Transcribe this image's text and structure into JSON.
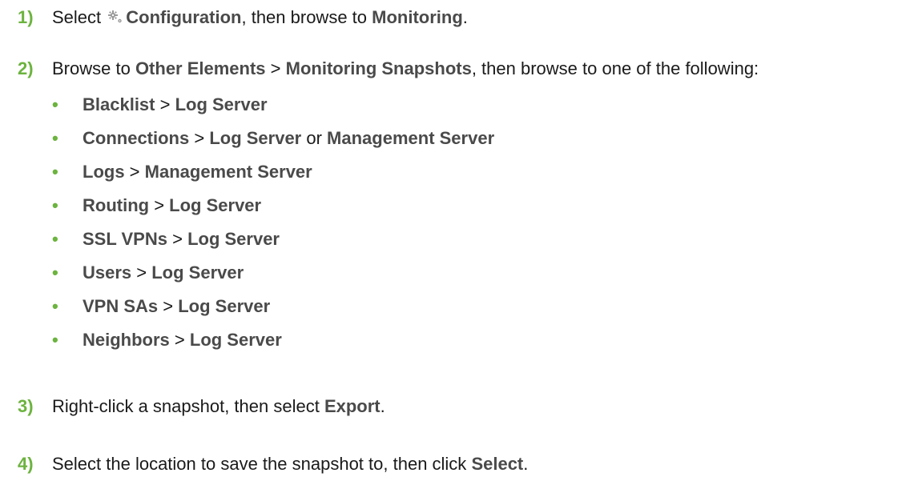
{
  "steps": [
    {
      "number": "1)",
      "select": "Select",
      "gear_icon": "gear-icon",
      "configuration": "Configuration",
      "then_browse": ", then browse to ",
      "monitoring": "Monitoring",
      "end": "."
    },
    {
      "number": "2)",
      "browse": "Browse to ",
      "other_elements": "Other Elements",
      "sep": " > ",
      "monitoring_snapshots": "Monitoring Snapshots",
      "rest": ", then browse to one of the following:",
      "items": [
        {
          "a": "Blacklist",
          "sep": " > ",
          "b": "Log Server"
        },
        {
          "a": "Connections",
          "sep": " > ",
          "b": "Log Server",
          "or": " or ",
          "c": "Management Server"
        },
        {
          "a": "Logs",
          "sep": " > ",
          "b": "Management Server"
        },
        {
          "a": "Routing",
          "sep": " > ",
          "b": "Log Server"
        },
        {
          "a": "SSL VPNs",
          "sep": " > ",
          "b": "Log Server"
        },
        {
          "a": "Users",
          "sep": " > ",
          "b": "Log Server"
        },
        {
          "a": "VPN SAs",
          "sep": " > ",
          "b": "Log Server"
        },
        {
          "a": "Neighbors",
          "sep": " > ",
          "b": "Log Server"
        }
      ]
    },
    {
      "number": "3)",
      "pre": "Right-click a snapshot, then select ",
      "export": "Export",
      "end": "."
    },
    {
      "number": "4)",
      "pre": "Select the location to save the snapshot to, then click ",
      "select": "Select",
      "end": "."
    }
  ],
  "bullet_char": "•",
  "colors": {
    "accent": "#6cb33f",
    "bold_text": "#4a4a4a",
    "text": "#1a1a1a"
  }
}
